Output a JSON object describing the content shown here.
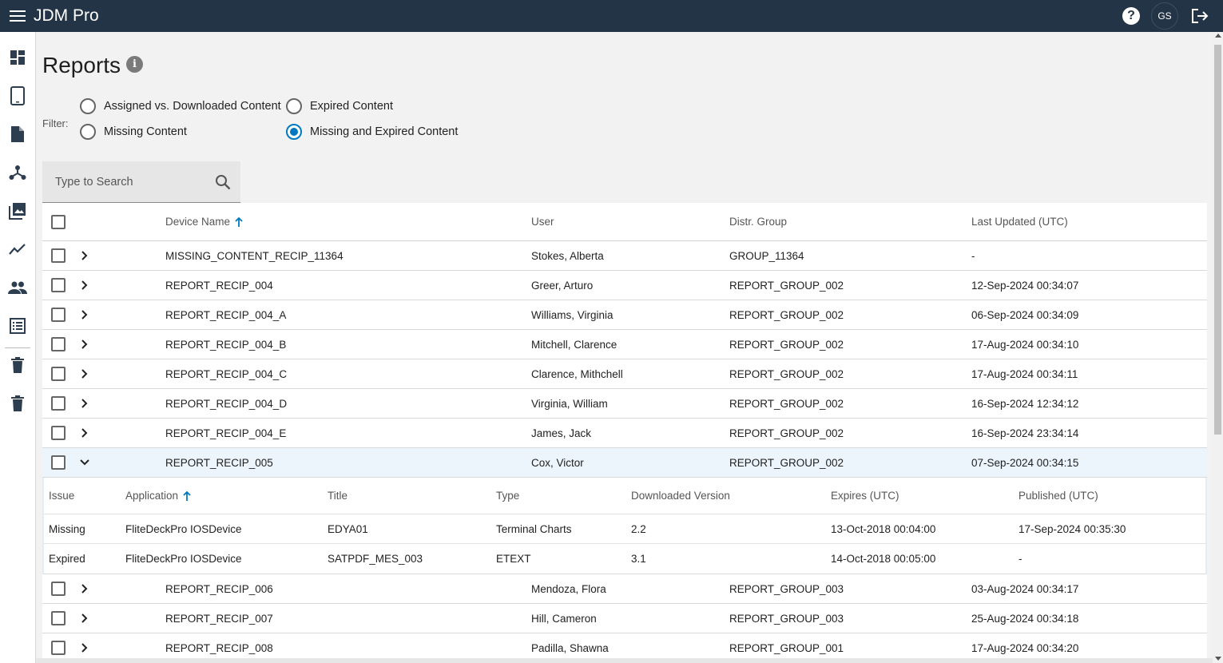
{
  "app": {
    "title": "JDM Pro"
  },
  "header": {
    "help_label": "?",
    "avatar_initials": "GS"
  },
  "page": {
    "title": "Reports",
    "info_label": "i"
  },
  "filter": {
    "label": "Filter:",
    "options": [
      {
        "label": "Assigned vs. Downloaded Content",
        "checked": false
      },
      {
        "label": "Expired Content",
        "checked": false
      },
      {
        "label": "Missing Content",
        "checked": false
      },
      {
        "label": "Missing and Expired Content",
        "checked": true
      }
    ]
  },
  "search": {
    "placeholder": "Type to Search",
    "value": ""
  },
  "table": {
    "columns": {
      "device": "Device Name",
      "user": "User",
      "group": "Distr. Group",
      "updated": "Last Updated (UTC)"
    },
    "rows": [
      {
        "device": "MISSING_CONTENT_RECIP_11364",
        "user": "Stokes, Alberta",
        "group": "GROUP_11364",
        "updated": "-"
      },
      {
        "device": "REPORT_RECIP_004",
        "user": "Greer, Arturo",
        "group": "REPORT_GROUP_002",
        "updated": "12-Sep-2024 00:34:07"
      },
      {
        "device": "REPORT_RECIP_004_A",
        "user": "Williams, Virginia",
        "group": "REPORT_GROUP_002",
        "updated": "06-Sep-2024 00:34:09"
      },
      {
        "device": "REPORT_RECIP_004_B",
        "user": "Mitchell, Clarence",
        "group": "REPORT_GROUP_002",
        "updated": "17-Aug-2024 00:34:10"
      },
      {
        "device": "REPORT_RECIP_004_C",
        "user": "Clarence, Mithchell",
        "group": "REPORT_GROUP_002",
        "updated": "17-Aug-2024 00:34:11"
      },
      {
        "device": "REPORT_RECIP_004_D",
        "user": "Virginia, William",
        "group": "REPORT_GROUP_002",
        "updated": "16-Sep-2024 12:34:12"
      },
      {
        "device": "REPORT_RECIP_004_E",
        "user": "James, Jack",
        "group": "REPORT_GROUP_002",
        "updated": "16-Sep-2024 23:34:14"
      },
      {
        "device": "REPORT_RECIP_005",
        "user": "Cox, Victor",
        "group": "REPORT_GROUP_002",
        "updated": "07-Sep-2024 00:34:15"
      },
      {
        "device": "REPORT_RECIP_006",
        "user": "Mendoza, Flora",
        "group": "REPORT_GROUP_003",
        "updated": "03-Aug-2024 00:34:17"
      },
      {
        "device": "REPORT_RECIP_007",
        "user": "Hill, Cameron",
        "group": "REPORT_GROUP_003",
        "updated": "25-Aug-2024 00:34:18"
      },
      {
        "device": "REPORT_RECIP_008",
        "user": "Padilla, Shawna",
        "group": "REPORT_GROUP_001",
        "updated": "17-Aug-2024 00:34:20"
      }
    ],
    "detail": {
      "columns": {
        "issue": "Issue",
        "application": "Application",
        "title": "Title",
        "type": "Type",
        "version": "Downloaded Version",
        "expires": "Expires (UTC)",
        "published": "Published (UTC)"
      },
      "rows": [
        {
          "issue": "Missing",
          "application": "FliteDeckPro IOSDevice",
          "title": "EDYA01",
          "type": "Terminal Charts",
          "version": "2.2",
          "expires": "13-Oct-2018 00:04:00",
          "published": "17-Sep-2024 00:35:30"
        },
        {
          "issue": "Expired",
          "application": "FliteDeckPro IOSDevice",
          "title": "SATPDF_MES_003",
          "type": "ETEXT",
          "version": "3.1",
          "expires": "14-Oct-2018 00:05:00",
          "published": "-"
        }
      ]
    }
  },
  "sidebar": {
    "items": [
      {
        "icon": "dashboard-icon"
      },
      {
        "icon": "tablet-icon"
      },
      {
        "icon": "document-icon"
      },
      {
        "icon": "hierarchy-icon"
      },
      {
        "icon": "image-library-icon"
      },
      {
        "icon": "trend-chart-icon"
      },
      {
        "icon": "people-icon"
      },
      {
        "icon": "list-icon"
      },
      {
        "icon": "trash-icon"
      },
      {
        "icon": "trash-icon"
      }
    ]
  },
  "colors": {
    "topbar": "#243447",
    "accent": "#0079c1",
    "expanded_row": "#ecf5fc"
  }
}
